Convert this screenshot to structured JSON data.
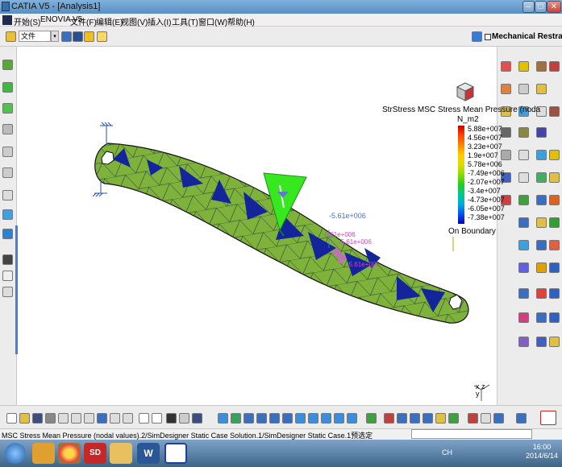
{
  "window": {
    "title": "CATIA V5 - [Analysis1]",
    "minimize_glyph": "–",
    "maximize_glyph": "□",
    "close_glyph": "✕"
  },
  "menu": {
    "items": [
      "开始(S)",
      "ENOVIA V5",
      "文件(F)",
      "编辑(E)",
      "视图(V)",
      "插入(I)",
      "工具(T)",
      "窗口(W)",
      "帮助(H)"
    ]
  },
  "toolbar": {
    "file_combo_value": "文件",
    "combo_arrow_glyph": "▾",
    "mechanical_restraint_label": "Mechanical Restraint"
  },
  "legend": {
    "title": "StrStress MSC Stress Mean Pressure (noda",
    "unit": "N_m2",
    "values": [
      "5.88e+007",
      "4.56e+007",
      "3.23e+007",
      "1.9e+007",
      "5.78e+006",
      "-7.49e+006",
      "-2.07e+007",
      "-3.4e+007",
      "-4.73e+007",
      "-6.05e+007",
      "-7.38e+007"
    ],
    "on_boundary": "On Boundary",
    "colors": [
      "#cc0000",
      "#ff4400",
      "#ff8800",
      "#ffcc00",
      "#dddd00",
      "#88dd00",
      "#22cc22",
      "#00cc88",
      "#00aadd",
      "#0055ee",
      "#0000bb"
    ]
  },
  "annotations": {
    "main_value": "-5.61e+006",
    "small_values": [
      "-5.61e+006",
      "-5.61e+006",
      "-5.61e+006"
    ]
  },
  "axis_labels": {
    "x": "x",
    "y": "y",
    "z": "z"
  },
  "status": {
    "text": "MSC Stress Mean Pressure (nodal values).2/SimDesigner Static Case Solution.1/SimDesigner Static Case.1预选定"
  },
  "taskbar": {
    "time": "16:00",
    "date": "2014/6/14",
    "tray_text": "CH",
    "sd_label": "SD",
    "word_label": "W"
  },
  "colors": {
    "mesh_green": "#7fb23a",
    "mesh_blue": "#14249b",
    "load_green": "#38e81f"
  }
}
